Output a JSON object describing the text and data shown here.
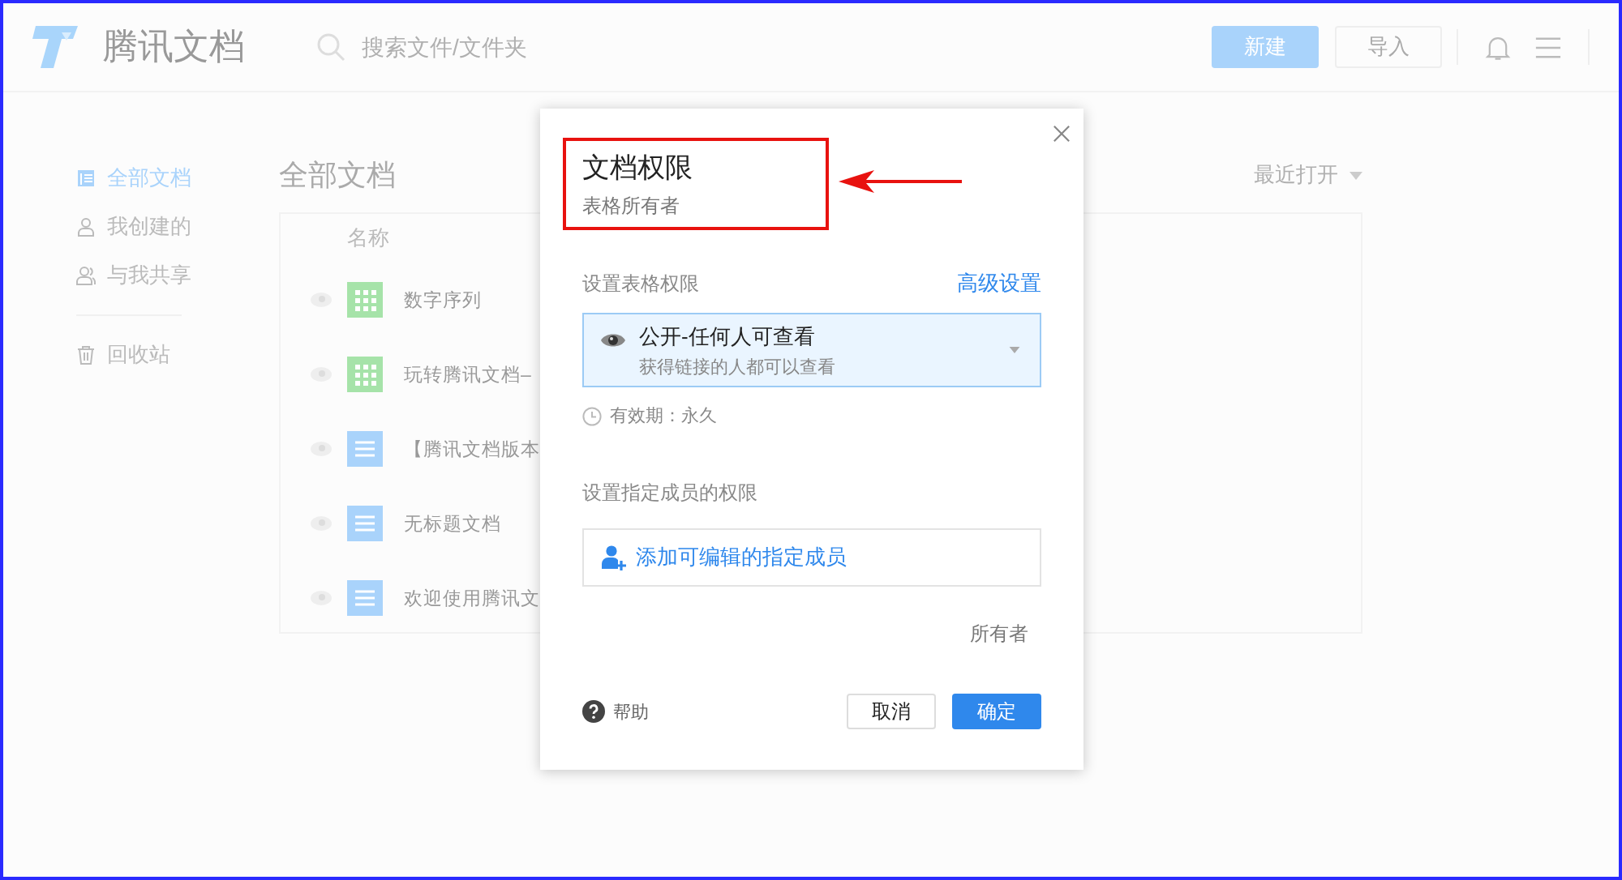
{
  "header": {
    "logo_text": "腾讯文档",
    "search": {
      "placeholder": "搜索文件/文件夹"
    },
    "buttons": [
      {
        "label": "新建",
        "kind": "primary"
      },
      {
        "label": "导入",
        "kind": "default"
      }
    ]
  },
  "sidebar": {
    "items": [
      {
        "label": "全部文档",
        "kind": "docs",
        "selected": true
      },
      {
        "label": "我创建的",
        "kind": "person",
        "selected": false
      },
      {
        "label": "与我共享",
        "kind": "people",
        "selected": false
      },
      {
        "label": "回收站",
        "kind": "trash",
        "selected": false
      }
    ]
  },
  "main": {
    "title": "全部文档",
    "sort": "最近打开",
    "table": {
      "columns": [
        "名称"
      ],
      "rows": [
        {
          "name": "数字序列",
          "kind": "sheet"
        },
        {
          "name": "玩转腾讯文档–",
          "kind": "sheet"
        },
        {
          "name": "【腾讯文档版本",
          "kind": "doc"
        },
        {
          "name": "无标题文档",
          "kind": "doc"
        },
        {
          "name": "欢迎使用腾讯文",
          "kind": "doc"
        }
      ]
    }
  },
  "dialog": {
    "title": "文档权限",
    "subtitle": "表格所有者",
    "permission_label": "设置表格权限",
    "advanced_link": "高级设置",
    "permission": {
      "title": "公开-任何人可查看",
      "description": "获得链接的人都可以查看"
    },
    "validity": "有效期：永久",
    "members_label": "设置指定成员的权限",
    "add_member": "添加可编辑的指定成员",
    "owner": "所有者",
    "help": "帮助",
    "buttons": [
      {
        "label": "取消",
        "kind": "default"
      },
      {
        "label": "确定",
        "kind": "primary"
      }
    ]
  }
}
